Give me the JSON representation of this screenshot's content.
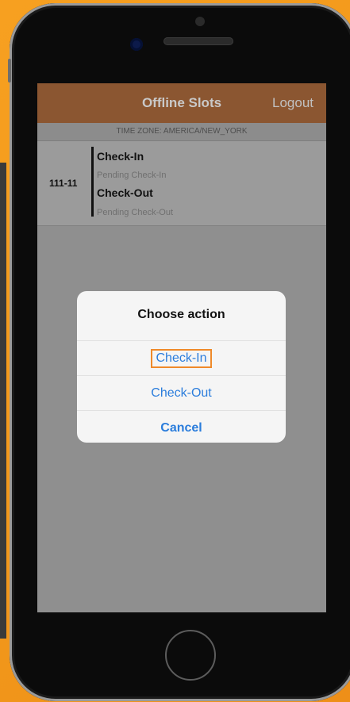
{
  "header": {
    "title": "Offline Slots",
    "logout_label": "Logout"
  },
  "timezone": {
    "text": "TIME ZONE: AMERICA/NEW_YORK"
  },
  "slot": {
    "id": "111-11",
    "checkin_title": "Check-In",
    "checkin_status": "Pending Check-In",
    "checkout_title": "Check-Out",
    "checkout_status": "Pending Check-Out"
  },
  "dialog": {
    "title": "Choose action",
    "options": [
      "Check-In",
      "Check-Out"
    ],
    "cancel_label": "Cancel"
  },
  "colors": {
    "navbar": "#8b5631",
    "accent_link": "#2b7ddc",
    "background": "#f39a1c",
    "highlight": "#ef8a2a"
  }
}
